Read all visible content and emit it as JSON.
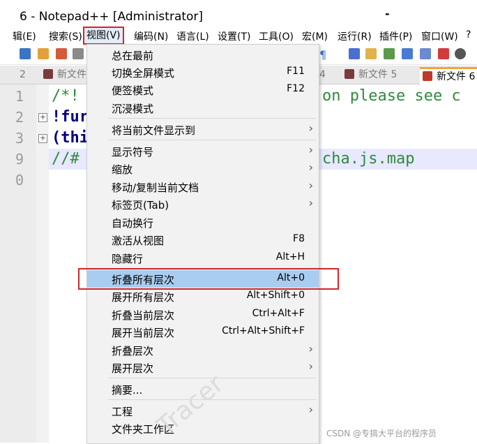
{
  "window": {
    "title": "6 - Notepad++ [Administrator]",
    "minimize_glyph": "-"
  },
  "menubar": {
    "items": [
      {
        "label": "辑(E)"
      },
      {
        "label": "搜索(S)"
      },
      {
        "label": "视图(V)"
      },
      {
        "label": "编码(N)"
      },
      {
        "label": "语言(L)"
      },
      {
        "label": "设置(T)"
      },
      {
        "label": "工具(O)"
      },
      {
        "label": "宏(M)"
      },
      {
        "label": "运行(R)"
      },
      {
        "label": "插件(P)"
      },
      {
        "label": "窗口(W)"
      },
      {
        "label": "?"
      }
    ]
  },
  "toolbar": {
    "pilcrow": "¶"
  },
  "tabs": [
    {
      "label": "2"
    },
    {
      "label": "新文件"
    },
    {
      "label": "4"
    },
    {
      "label": "新文件 5"
    },
    {
      "label": "新文件 6"
    }
  ],
  "editor": {
    "line_numbers": [
      "1",
      "2",
      "3",
      "9",
      "0"
    ],
    "lines": [
      {
        "text": "/*!",
        "tail": "on please see c"
      },
      {
        "text": "!fur"
      },
      {
        "text": "(thi"
      },
      {
        "text": "//#",
        "tail": "cha.js.map"
      }
    ]
  },
  "view_menu": {
    "items": [
      {
        "label": "总在最前",
        "shortcut": "",
        "submenu": false
      },
      {
        "label": "切换全屏模式",
        "shortcut": "F11",
        "submenu": false
      },
      {
        "label": "便签模式",
        "shortcut": "F12",
        "submenu": false
      },
      {
        "label": "沉浸模式",
        "shortcut": "",
        "submenu": false
      },
      {
        "label": "将当前文件显示到",
        "shortcut": "",
        "submenu": true
      },
      {
        "label": "显示符号",
        "shortcut": "",
        "submenu": true
      },
      {
        "label": "缩放",
        "shortcut": "",
        "submenu": true
      },
      {
        "label": "移动/复制当前文档",
        "shortcut": "",
        "submenu": true
      },
      {
        "label": "标签页(Tab)",
        "shortcut": "",
        "submenu": true
      },
      {
        "label": "自动换行",
        "shortcut": "",
        "submenu": false
      },
      {
        "label": "激活从视图",
        "shortcut": "F8",
        "submenu": false
      },
      {
        "label": "隐藏行",
        "shortcut": "Alt+H",
        "submenu": false
      },
      {
        "label": "折叠所有层次",
        "shortcut": "Alt+0",
        "submenu": false,
        "highlighted": true
      },
      {
        "label": "展开所有层次",
        "shortcut": "Alt+Shift+0",
        "submenu": false
      },
      {
        "label": "折叠当前层次",
        "shortcut": "Ctrl+Alt+F",
        "submenu": false
      },
      {
        "label": "展开当前层次",
        "shortcut": "Ctrl+Alt+Shift+F",
        "submenu": false
      },
      {
        "label": "折叠层次",
        "shortcut": "",
        "submenu": true
      },
      {
        "label": "展开层次",
        "shortcut": "",
        "submenu": true
      },
      {
        "label": "摘要...",
        "shortcut": "",
        "submenu": false
      },
      {
        "label": "工程",
        "shortcut": "",
        "submenu": true
      },
      {
        "label": "文件夹工作区",
        "shortcut": "",
        "submenu": false
      }
    ],
    "submenu_arrow": "›"
  },
  "watermark": {
    "csdn": "CSDN @专搞大平台的程序员",
    "ghost": "Tracer"
  },
  "colors": {
    "highlight": "#a9cdf0",
    "annotation_red": "#d0262c",
    "comment_green": "#2f8a3c",
    "tab_active_accent": "#f3a43a"
  }
}
